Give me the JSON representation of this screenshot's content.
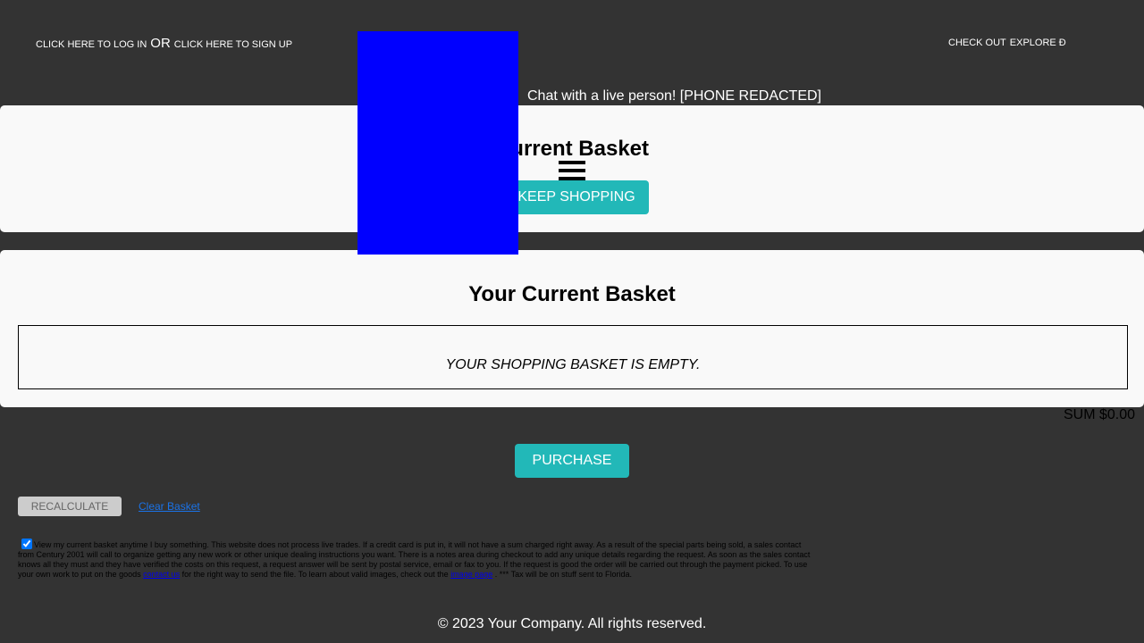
{
  "topnav": {
    "login": "Click here to log in",
    "or": "OR",
    "signup": "Click here to sign up",
    "checkout": "Check out",
    "explore": "Explore ð"
  },
  "chat": "Chat with a live person! [PHONE REDACTED]",
  "card1": {
    "title": "Current Basket",
    "keep_shopping": "KEEP SHOPPING"
  },
  "card2": {
    "title": "Your Current Basket",
    "empty": "Your shopping basket is empty."
  },
  "sum": "SUM $0.00",
  "purchase": "PURCHASE",
  "recalculate": "RECALCULATE",
  "clear_basket": "Clear Basket",
  "notice": {
    "part1": "View my current basket anytime I buy something. This website does not process live trades. If a credit card is put in, it will not have a sum charged right away. As a result of the special parts being sold, a sales contact from Century 2001 will call to organize getting any new work or other unique dealing instructions you want. There is a notes area during checkout to add any unique details regarding the request. As soon as the sales contact knows all they must and they have verified the costs on this request, a request answer will be sent by postal service, email or fax to you. If the request is good the order will be carried out through the payment picked. To use your own work to put on the goods",
    "contact_link": "contact us",
    "part2": "for the right way to send the file. To learn about valid images, check out the",
    "image_link": "image page",
    "part3": ". *** Tax will be on stuff sent to Florida."
  },
  "footer": "© 2023 Your Company. All rights reserved."
}
